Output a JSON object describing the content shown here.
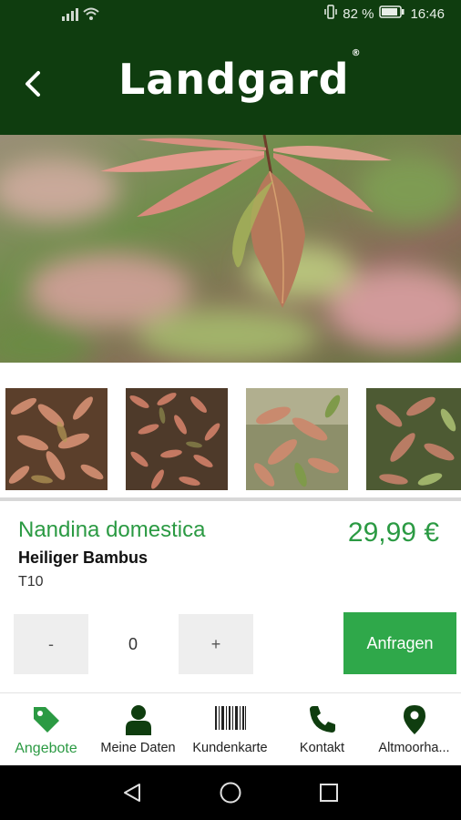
{
  "status_bar": {
    "battery_percent": "82 %",
    "time": "16:46"
  },
  "header": {
    "logo_text": "Landgard",
    "logo_mark": "®"
  },
  "product": {
    "botanical_name": "Nandina domestica",
    "common_name": "Heiliger Bambus",
    "code": "T10",
    "price": "29,99 €"
  },
  "quantity": {
    "minus_label": "-",
    "value": "0",
    "plus_label": "+"
  },
  "request_button_label": "Anfragen",
  "bottom_nav": {
    "items": [
      {
        "label": "Angebote",
        "icon": "tag-icon",
        "active": true
      },
      {
        "label": "Meine Daten",
        "icon": "person-icon",
        "active": false
      },
      {
        "label": "Kundenkarte",
        "icon": "barcode-icon",
        "active": false
      },
      {
        "label": "Kontakt",
        "icon": "phone-icon",
        "active": false
      },
      {
        "label": "Altmoorha...",
        "icon": "location-pin-icon",
        "active": false
      }
    ]
  },
  "colors": {
    "header_bg": "#0f3d0f",
    "accent_green": "#2b9a43",
    "button_green": "#2fa84a"
  }
}
